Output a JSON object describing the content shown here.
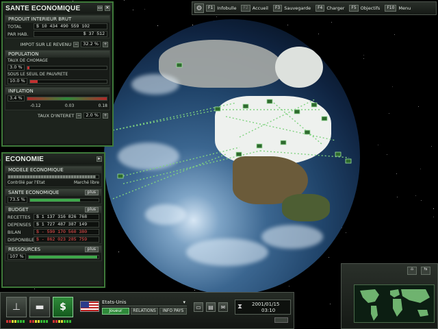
{
  "toolbar": {
    "items": [
      {
        "key": "F1",
        "label": "Infobulle"
      },
      {
        "key": "F2",
        "label": "Accueil"
      },
      {
        "key": "F3",
        "label": "Sauvegarde"
      },
      {
        "key": "F4",
        "label": "Charger"
      },
      {
        "key": "F5",
        "label": "Objectifs"
      },
      {
        "key": "F10",
        "label": "Menu"
      }
    ]
  },
  "sante_panel": {
    "title": "SANTE ECONOMIQUE",
    "pib": {
      "header": "PRODUIT INTERIEUR BRUT",
      "total_label": "TOTAL",
      "total_value": "$ 10 434 490 559 102",
      "par_hab_label": "PAR HAB.",
      "par_hab_value": "$ 37 512"
    },
    "impot_label": "IMPOT SUR LE REVENU",
    "impot_value": "32.2 %",
    "impot_level": 0.32,
    "population": {
      "header": "POPULATION",
      "chomage_label": "TAUX DE CHOMAGE",
      "chomage_value": "3.0 %",
      "chomage_level": 0.03,
      "pauvrete_label": "SOUS LE SEUIL DE PAUVRETE",
      "pauvrete_value": "10.0 %",
      "pauvrete_level": 0.1
    },
    "inflation": {
      "header": "INFLATION",
      "value": "3.4 %",
      "ticks": [
        "-0.12",
        "0.03",
        "0.18"
      ],
      "taux_label": "TAUX D'INTERET",
      "taux_value": "2.0 %"
    }
  },
  "economie_panel": {
    "title": "ECONOMIE",
    "modele": {
      "header": "MODELE ECONOMIQUE",
      "left_label": "Contrôlé par l'Etat",
      "right_label": "Marché libre",
      "level": 0.97
    },
    "sante": {
      "header": "SANTE ECONOMIQUE",
      "plus": "plus",
      "value": "73.5 %",
      "level": 0.735
    },
    "budget": {
      "header": "BUDGET",
      "plus": "plus",
      "recettes_label": "RECETTES",
      "recettes_value": "$ 1 137 316 826 768",
      "depenses_label": "DEPENSES",
      "depenses_value": "$ 1 727 487 387 149",
      "bilan_label": "BILAN",
      "bilan_value": "$ - 590 170 560 380",
      "disponible_label": "DISPONIBLE",
      "disponible_value": "$ - 862 023 285 759"
    },
    "ressources": {
      "header": "RESSOURCES",
      "plus": "plus",
      "value": "107 %",
      "level": 0.98
    }
  },
  "bottom": {
    "country": "Etats-Unis",
    "tabs": [
      "Joueur",
      "RELATIONS",
      "INFO PAYS"
    ],
    "date": "2001/01/15",
    "time": "03:10",
    "money_symbol": "$"
  },
  "colors": {
    "accent": "#2f8a3a",
    "panel_border": "#3f7a3a",
    "negative": "#ff5555"
  }
}
